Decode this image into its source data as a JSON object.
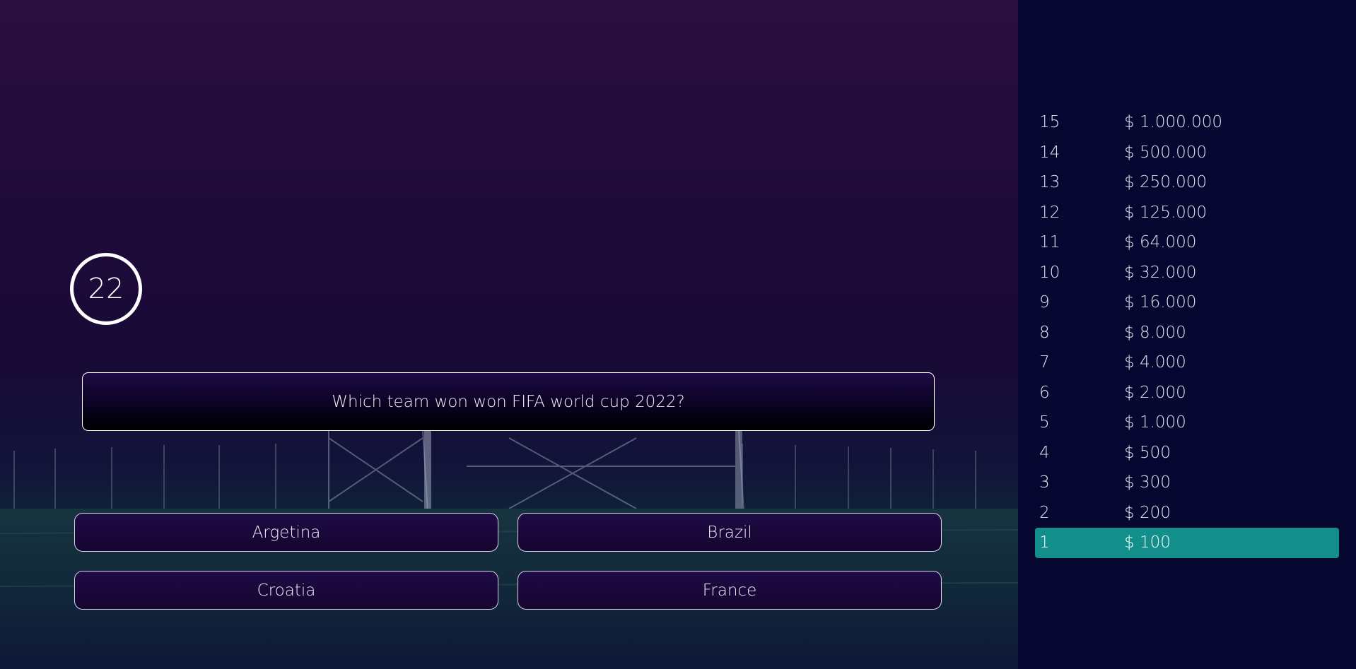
{
  "game": {
    "timer": "22",
    "question": "Which team won won FIFA world cup 2022?",
    "answers": [
      "Argetina",
      "Brazil",
      "Croatia",
      "France"
    ]
  },
  "ladder": [
    {
      "level": "15",
      "amount": "$ 1.000.000"
    },
    {
      "level": "14",
      "amount": "$ 500.000"
    },
    {
      "level": "13",
      "amount": "$ 250.000"
    },
    {
      "level": "12",
      "amount": "$ 125.000"
    },
    {
      "level": "11",
      "amount": "$ 64.000"
    },
    {
      "level": "10",
      "amount": "$ 32.000"
    },
    {
      "level": "9",
      "amount": "$ 16.000"
    },
    {
      "level": "8",
      "amount": "$ 8.000"
    },
    {
      "level": "7",
      "amount": "$ 4.000"
    },
    {
      "level": "6",
      "amount": "$ 2.000"
    },
    {
      "level": "5",
      "amount": "$ 1.000"
    },
    {
      "level": "4",
      "amount": "$ 500"
    },
    {
      "level": "3",
      "amount": "$ 300"
    },
    {
      "level": "2",
      "amount": "$ 200"
    },
    {
      "level": "1",
      "amount": "$ 100"
    }
  ],
  "colors": {
    "sidebar_bg": "#050731",
    "active_level": "#128f8b",
    "border": "#ffffff"
  },
  "active_level": "1"
}
